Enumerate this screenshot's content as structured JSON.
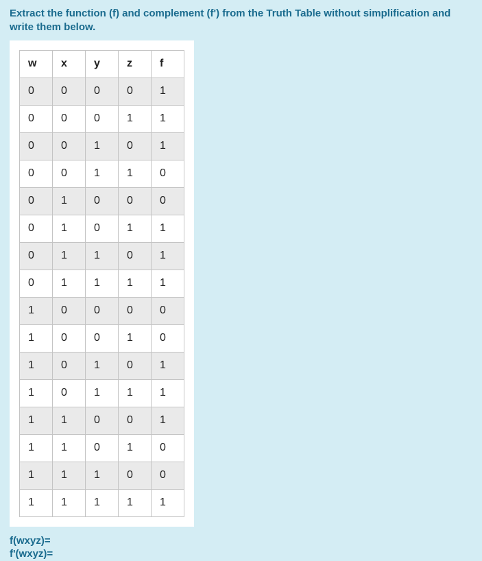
{
  "instruction": "Extract the function (f) and complement (f') from the Truth Table without simplification and write them below.",
  "table": {
    "headers": [
      "w",
      "x",
      "y",
      "z",
      "f"
    ],
    "rows": [
      [
        "0",
        "0",
        "0",
        "0",
        "1"
      ],
      [
        "0",
        "0",
        "0",
        "1",
        "1"
      ],
      [
        "0",
        "0",
        "1",
        "0",
        "1"
      ],
      [
        "0",
        "0",
        "1",
        "1",
        "0"
      ],
      [
        "0",
        "1",
        "0",
        "0",
        "0"
      ],
      [
        "0",
        "1",
        "0",
        "1",
        "1"
      ],
      [
        "0",
        "1",
        "1",
        "0",
        "1"
      ],
      [
        "0",
        "1",
        "1",
        "1",
        "1"
      ],
      [
        "1",
        "0",
        "0",
        "0",
        "0"
      ],
      [
        "1",
        "0",
        "0",
        "1",
        "0"
      ],
      [
        "1",
        "0",
        "1",
        "0",
        "1"
      ],
      [
        "1",
        "0",
        "1",
        "1",
        "1"
      ],
      [
        "1",
        "1",
        "0",
        "0",
        "1"
      ],
      [
        "1",
        "1",
        "0",
        "1",
        "0"
      ],
      [
        "1",
        "1",
        "1",
        "0",
        "0"
      ],
      [
        "1",
        "1",
        "1",
        "1",
        "1"
      ]
    ]
  },
  "answers": {
    "f_label": "f(wxyz)=",
    "fprime_label": "f'(wxyz)="
  }
}
